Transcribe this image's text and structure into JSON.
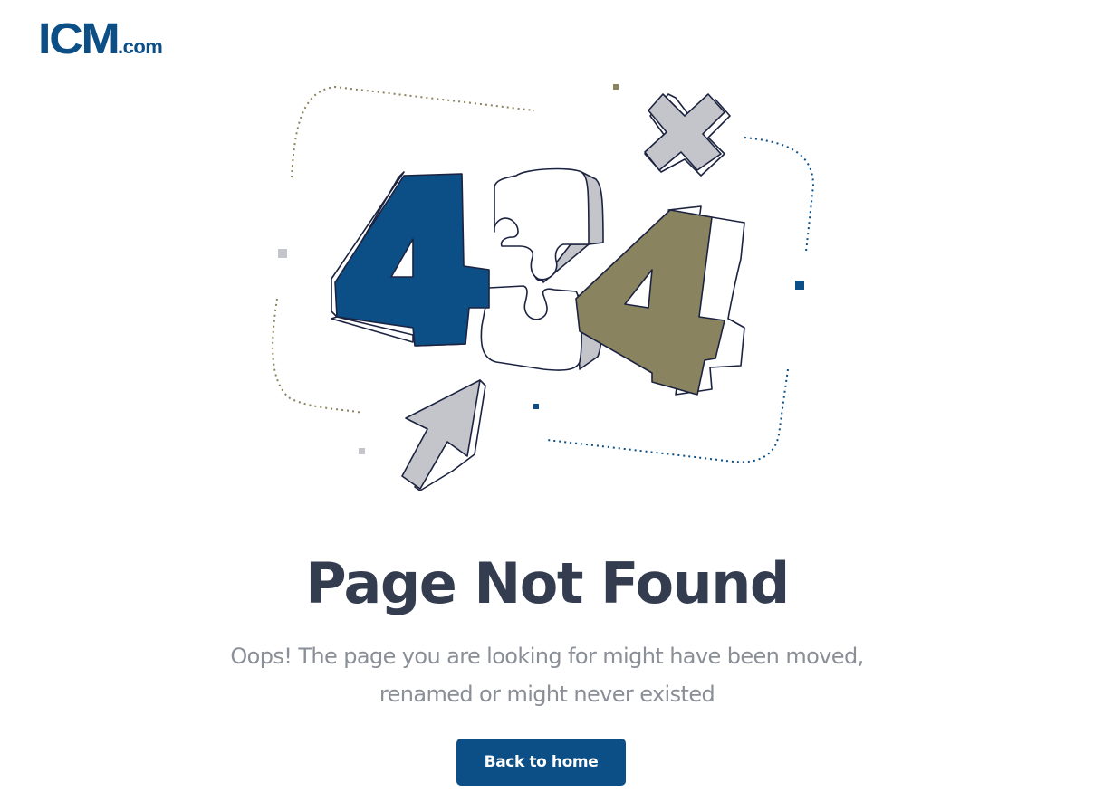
{
  "logo": {
    "main": "ICM",
    "suffix": ".com"
  },
  "illustration": {
    "left_digit": "4",
    "right_digit": "4",
    "colors": {
      "primary": "#0b4f86",
      "olive": "#8a835f",
      "gray": "#c4c5ca",
      "outline": "#1c2340"
    }
  },
  "title": "Page Not Found",
  "message": {
    "line1": "Oops! The page you are looking for might have been moved,",
    "line2": "renamed or might never existed"
  },
  "button": {
    "label": "Back to home"
  },
  "colors": {
    "brand": "#0b4f86",
    "heading": "#333d4f",
    "body_text": "#8a8f97"
  }
}
